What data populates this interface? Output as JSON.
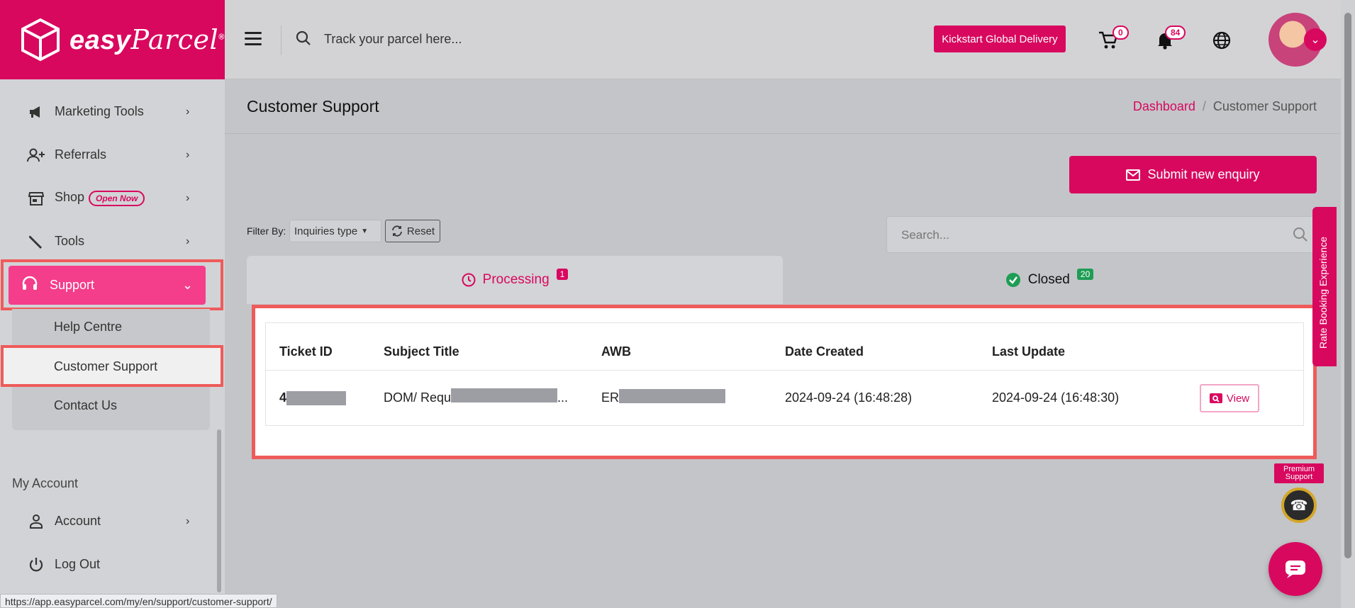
{
  "brand": {
    "name_bold": "easy",
    "name_script": "Parcel",
    "reg": "®"
  },
  "sidebar": {
    "items": [
      {
        "label": "Marketing Tools",
        "icon": "megaphone-icon"
      },
      {
        "label": "Referrals",
        "icon": "add-user-icon"
      },
      {
        "label": "Shop",
        "icon": "store-icon",
        "badge": "Open Now"
      },
      {
        "label": "Tools",
        "icon": "wrench-icon"
      }
    ],
    "support": {
      "label": "Support",
      "icon": "headset-icon"
    },
    "submenu": [
      "Help Centre",
      "Customer Support",
      "Contact Us"
    ],
    "section_title": "My Account",
    "account": {
      "label": "Account",
      "icon": "user-icon"
    },
    "logout": {
      "label": "Log Out",
      "icon": "power-icon"
    }
  },
  "header": {
    "track_placeholder": "Track your parcel here...",
    "kickstart_label": "Kickstart Global Delivery",
    "cart_count": "0",
    "notif_count": "84"
  },
  "page": {
    "title": "Customer Support",
    "breadcrumb": {
      "home": "Dashboard",
      "current": "Customer Support"
    },
    "submit_label": "Submit new enquiry",
    "filter_label": "Filter By:",
    "filter_value": "Inquiries type",
    "reset_label": "Reset",
    "search_placeholder": "Search..."
  },
  "tabs": {
    "processing": {
      "label": "Processing",
      "count": "1"
    },
    "closed": {
      "label": "Closed",
      "count": "20"
    }
  },
  "table": {
    "headers": [
      "Ticket ID",
      "Subject Title",
      "AWB",
      "Date Created",
      "Last Update"
    ],
    "rows": [
      {
        "ticket_id": "4",
        "subject": "DOM/ Requ",
        "subject_tail": "...",
        "awb": "ER",
        "date_created": "2024-09-24 (16:48:28)",
        "last_update": "2024-09-24 (16:48:30)",
        "action": "View"
      }
    ]
  },
  "rate_tab": "Rate Booking Experience",
  "premium": "Premium Support",
  "status_url": "https://app.easyparcel.com/my/en/support/customer-support/",
  "colors": {
    "brand": "#d8085f",
    "support_active": "#f43d8b",
    "highlight_frame": "#ef5b5b",
    "closed_badge": "#1f9d55"
  }
}
